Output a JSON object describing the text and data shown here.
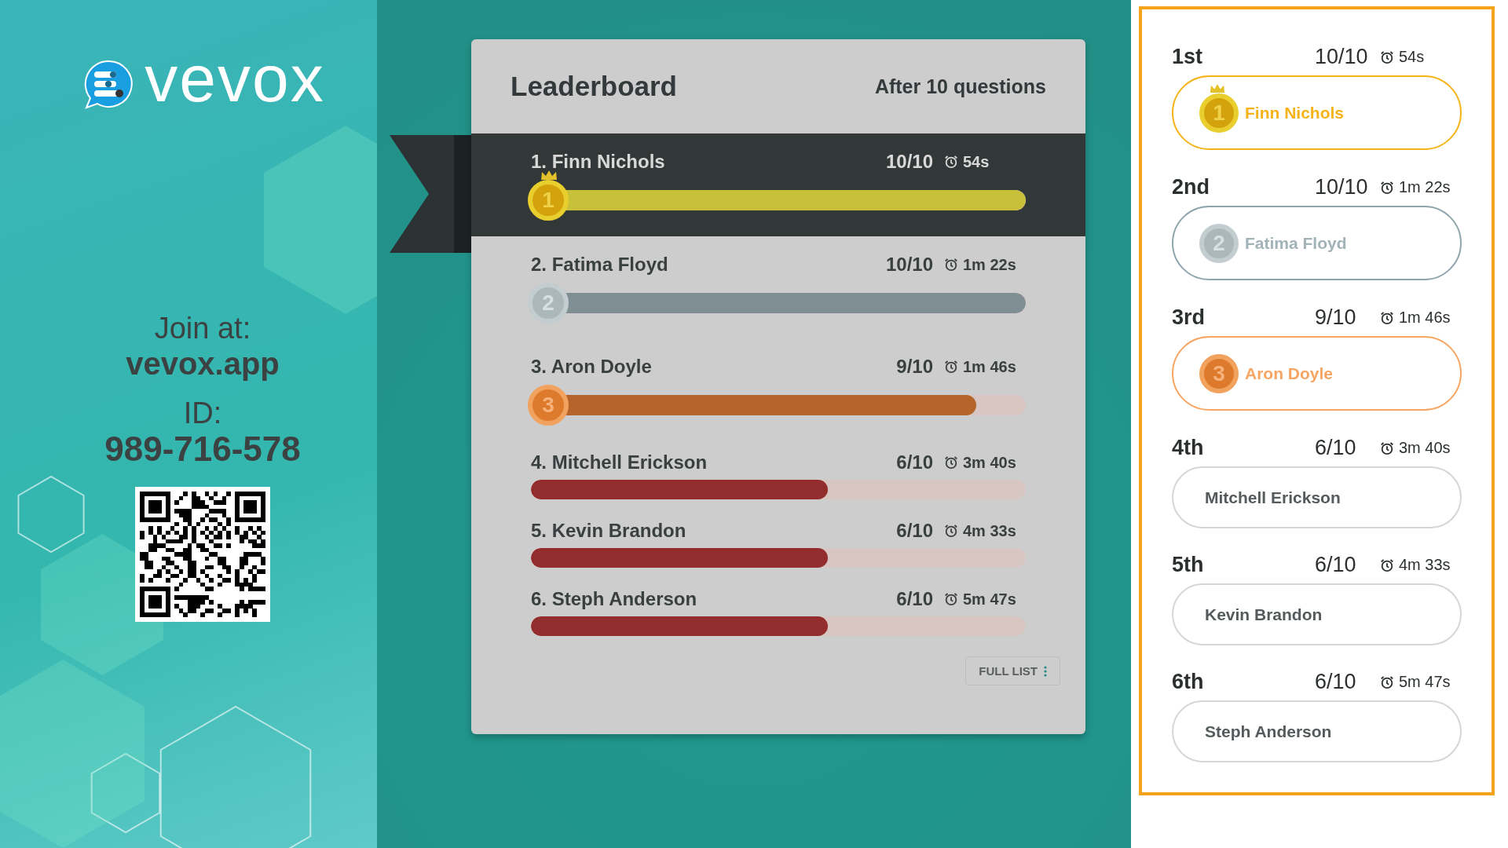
{
  "logo": {
    "wordmark": "vevox"
  },
  "join": {
    "label": "Join at:",
    "url": "vevox.app",
    "id_label": "ID:",
    "id": "989-716-578"
  },
  "leaderboard": {
    "title": "Leaderboard",
    "subtitle": "After 10 questions",
    "button": "FULL LIST",
    "rows": [
      {
        "label": "1. Finn Nichols",
        "score": "10/10",
        "time": "54s",
        "kind": "gold",
        "medal": "1",
        "selected": true,
        "level": 1,
        "color": "#c9c039"
      },
      {
        "label": "2. Fatima Floyd",
        "score": "10/10",
        "time": "1m 22s",
        "kind": "silver",
        "medal": "2",
        "selected": false,
        "level": 1,
        "color": "#7f8e92"
      },
      {
        "label": "3. Aron Doyle",
        "score": "9/10",
        "time": "1m 46s",
        "kind": "bronze",
        "medal": "3",
        "selected": false,
        "level": 0.9,
        "color": "#b5642a"
      },
      {
        "label": "4. Mitchell Erickson",
        "score": "6/10",
        "time": "3m 40s",
        "kind": "plain",
        "selected": false,
        "level": 0.6,
        "color": "#932d2d"
      },
      {
        "label": "5. Kevin Brandon",
        "score": "6/10",
        "time": "4m 33s",
        "kind": "plain",
        "selected": false,
        "level": 0.6,
        "color": "#932d2d"
      },
      {
        "label": "6. Steph Anderson",
        "score": "6/10",
        "time": "5m 47s",
        "kind": "plain",
        "selected": false,
        "level": 0.6,
        "color": "#932d2d"
      }
    ]
  },
  "ranking": [
    {
      "rank": "1st",
      "score": "10/10",
      "time": "54s",
      "name": "Finn Nichols",
      "kind": "gold",
      "medal": "1"
    },
    {
      "rank": "2nd",
      "score": "10/10",
      "time": "1m 22s",
      "name": "Fatima Floyd",
      "kind": "silver",
      "medal": "2"
    },
    {
      "rank": "3rd",
      "score": "9/10",
      "time": "1m 46s",
      "name": "Aron Doyle",
      "kind": "bronze",
      "medal": "3"
    },
    {
      "rank": "4th",
      "score": "6/10",
      "time": "3m 40s",
      "name": "Mitchell Erickson",
      "kind": "plain"
    },
    {
      "rank": "5th",
      "score": "6/10",
      "time": "4m 33s",
      "name": "Kevin Brandon",
      "kind": "plain"
    },
    {
      "rank": "6th",
      "score": "6/10",
      "time": "5m 47s",
      "name": "Steph Anderson",
      "kind": "plain"
    }
  ]
}
